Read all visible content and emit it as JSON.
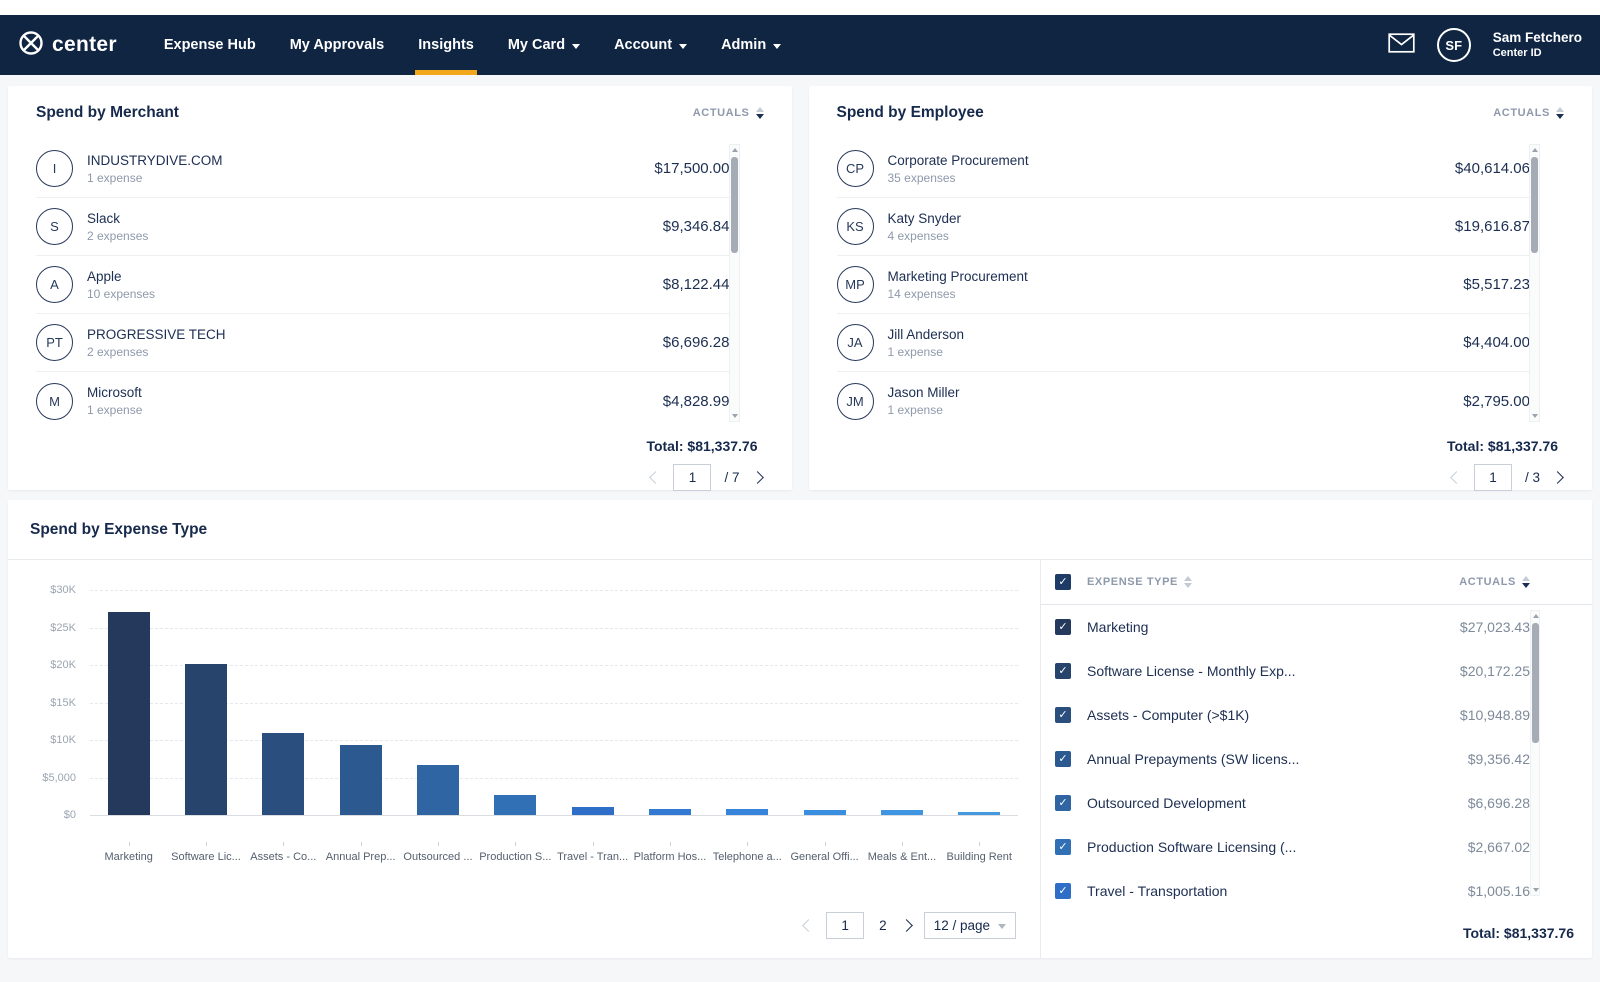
{
  "colors": {
    "navbar_bg": "#0F2542",
    "active_tab_underline": "#F2A71B",
    "page_bg": "#F6F7F9",
    "text_navy": "#1C2E52",
    "text_grey": "#8E99AB",
    "header_checkbox": "#1E3A66"
  },
  "navbar": {
    "logo_text": "center",
    "items": [
      {
        "label": "Expense Hub",
        "active": false,
        "dropdown": false
      },
      {
        "label": "My Approvals",
        "active": false,
        "dropdown": false
      },
      {
        "label": "Insights",
        "active": true,
        "dropdown": false
      },
      {
        "label": "My Card",
        "active": false,
        "dropdown": true
      },
      {
        "label": "Account",
        "active": false,
        "dropdown": true
      },
      {
        "label": "Admin",
        "active": false,
        "dropdown": true
      }
    ],
    "user": {
      "initials": "SF",
      "name": "Sam Fetchero",
      "subtitle": "Center ID"
    }
  },
  "merchant_card": {
    "title": "Spend by Merchant",
    "sort_label": "ACTUALS",
    "rows": [
      {
        "initials": "I",
        "name": "INDUSTRYDIVE.COM",
        "subtitle": "1 expense",
        "amount": "$17,500.00"
      },
      {
        "initials": "S",
        "name": "Slack",
        "subtitle": "2 expenses",
        "amount": "$9,346.84"
      },
      {
        "initials": "A",
        "name": "Apple",
        "subtitle": "10 expenses",
        "amount": "$8,122.44"
      },
      {
        "initials": "PT",
        "name": "PROGRESSIVE TECH",
        "subtitle": "2 expenses",
        "amount": "$6,696.28"
      },
      {
        "initials": "M",
        "name": "Microsoft",
        "subtitle": "1 expense",
        "amount": "$4,828.99"
      }
    ],
    "total_label": "Total:",
    "total_value": "$81,337.76",
    "pagination": {
      "current_page": "1",
      "of_pages": "/ 7"
    }
  },
  "employee_card": {
    "title": "Spend by Employee",
    "sort_label": "ACTUALS",
    "rows": [
      {
        "initials": "CP",
        "name": "Corporate Procurement",
        "subtitle": "35 expenses",
        "amount": "$40,614.06"
      },
      {
        "initials": "KS",
        "name": "Katy Snyder",
        "subtitle": "4 expenses",
        "amount": "$19,616.87"
      },
      {
        "initials": "MP",
        "name": "Marketing Procurement",
        "subtitle": "14 expenses",
        "amount": "$5,517.23"
      },
      {
        "initials": "JA",
        "name": "Jill Anderson",
        "subtitle": "1 expense",
        "amount": "$4,404.00"
      },
      {
        "initials": "JM",
        "name": "Jason Miller",
        "subtitle": "1 expense",
        "amount": "$2,795.00"
      }
    ],
    "total_label": "Total:",
    "total_value": "$81,337.76",
    "pagination": {
      "current_page": "1",
      "of_pages": "/ 3"
    }
  },
  "expense_card": {
    "title": "Spend by Expense Type",
    "pagination": {
      "current_page": "1",
      "next_page": "2",
      "page_size": "12 / page"
    },
    "table": {
      "col_type": "EXPENSE TYPE",
      "col_actuals": "ACTUALS",
      "rows": [
        {
          "label": "Marketing",
          "amount": "$27,023.43"
        },
        {
          "label": "Software License - Monthly Exp...",
          "amount": "$20,172.25"
        },
        {
          "label": "Assets - Computer (>$1K)",
          "amount": "$10,948.89"
        },
        {
          "label": "Annual Prepayments (SW licens...",
          "amount": "$9,356.42"
        },
        {
          "label": "Outsourced Development",
          "amount": "$6,696.28"
        },
        {
          "label": "Production Software Licensing (...",
          "amount": "$2,667.02"
        },
        {
          "label": "Travel - Transportation",
          "amount": "$1,005.16"
        }
      ],
      "total_label": "Total:",
      "total_value": "$81,337.76"
    }
  },
  "chart_data": {
    "type": "bar",
    "title": "Spend by Expense Type",
    "categories": [
      "Marketing",
      "Software Lic...",
      "Assets - Co...",
      "Annual Prep...",
      "Outsourced ...",
      "Production S...",
      "Travel - Tran...",
      "Platform Hos...",
      "Telephone a...",
      "General Offi...",
      "Meals & Ent...",
      "Building Rent"
    ],
    "values": [
      27023.43,
      20172.25,
      10948.89,
      9356.42,
      6696.28,
      2667.02,
      1005.16,
      760,
      750,
      620,
      660,
      400
    ],
    "ytick_labels": [
      "$30K",
      "$25K",
      "$20K",
      "$15K",
      "$10K",
      "$5,000",
      "$0"
    ],
    "ylim": [
      0,
      30000
    ],
    "grid": "dashed-horizontal",
    "legend": "none",
    "xlabel": "",
    "ylabel": "",
    "bar_colors": [
      "#24395B",
      "#27446C",
      "#2A4F7E",
      "#2C5A90",
      "#2F65A2",
      "#3170B4",
      "#2F6EC6",
      "#3279D2",
      "#3584DA",
      "#398EE0",
      "#3E95E2",
      "#4499DE"
    ],
    "total": "$81,337.76"
  }
}
